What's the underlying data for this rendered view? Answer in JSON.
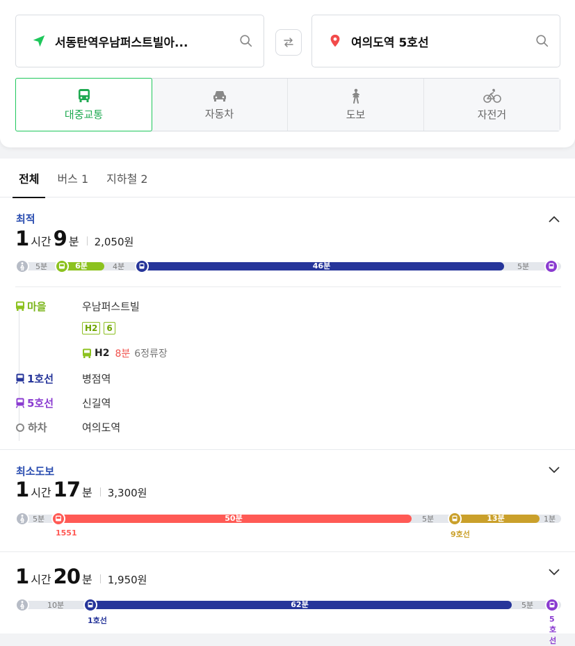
{
  "search": {
    "origin": "서동탄역우남퍼스트빌아...",
    "destination": "여의도역 5호선"
  },
  "modes": [
    {
      "label": "대중교통",
      "icon": "bus-icon",
      "active": true
    },
    {
      "label": "자동차",
      "icon": "car-icon",
      "active": false
    },
    {
      "label": "도보",
      "icon": "walk-icon",
      "active": false
    },
    {
      "label": "자전거",
      "icon": "bike-icon",
      "active": false
    }
  ],
  "tabs": [
    {
      "label": "전체",
      "active": true
    },
    {
      "label": "버스 1",
      "active": false
    },
    {
      "label": "지하철 2",
      "active": false
    }
  ],
  "routes": [
    {
      "label": "최적",
      "time": {
        "hours": "1",
        "hours_unit": "시간",
        "minutes": "9",
        "minutes_unit": "분"
      },
      "fare": "2,050원",
      "bar": {
        "walk_start": "5분",
        "seg1": "6분",
        "gap1": "4분",
        "seg2": "46분",
        "walk_end": "5분"
      },
      "steps": [
        {
          "kind": "마을",
          "place": "우남퍼스트빌",
          "badges": [
            "H2",
            "6"
          ],
          "sub_route": "H2",
          "sub_time": "8분",
          "sub_stops": "6정류장"
        },
        {
          "kind": "1호선",
          "place": "병점역"
        },
        {
          "kind": "5호선",
          "place": "신길역"
        },
        {
          "kind": "하차",
          "place": "여의도역"
        }
      ]
    },
    {
      "label": "최소도보",
      "time": {
        "hours": "1",
        "hours_unit": "시간",
        "minutes": "17",
        "minutes_unit": "분"
      },
      "fare": "3,300원",
      "bar": {
        "walk_start": "5분",
        "seg1": "50분",
        "seg1_under": "1551",
        "gap1": "5분",
        "seg2": "13분",
        "seg2_under": "9호선",
        "walk_end": "1분"
      }
    },
    {
      "label": "",
      "time": {
        "hours": "1",
        "hours_unit": "시간",
        "minutes": "20",
        "minutes_unit": "분"
      },
      "fare": "1,950원",
      "bar": {
        "walk_start": "10분",
        "seg1": "62분",
        "seg1_under": "1호선",
        "gap1": "5분",
        "end_under": "5호선"
      }
    }
  ],
  "colors": {
    "accent_green": "#1ec75b",
    "village_bus": "#8cc21f",
    "line1": "#26359a",
    "line5": "#8a3bd0",
    "line9": "#caa02b",
    "red_bus": "#ff5a55",
    "walk": "#b7bcc6",
    "label_blue": "#2a4db0"
  }
}
